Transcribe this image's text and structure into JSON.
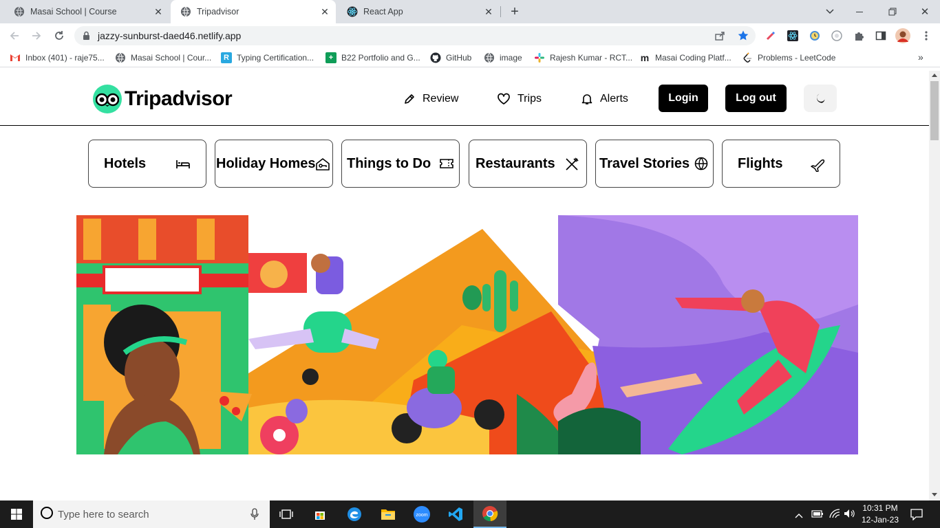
{
  "browser": {
    "tabs": [
      {
        "title": "Masai School | Course",
        "active": false
      },
      {
        "title": "Tripadvisor",
        "active": true
      },
      {
        "title": "React App",
        "active": false
      }
    ],
    "url": "jazzy-sunburst-daed46.netlify.app",
    "bookmarks": [
      {
        "label": "Inbox (401) - raje75...",
        "icon": "gmail-icon"
      },
      {
        "label": "Masai School | Cour...",
        "icon": "globe-icon"
      },
      {
        "label": "Typing Certification...",
        "icon": "typing-icon"
      },
      {
        "label": "B22 Portfolio and G...",
        "icon": "sheets-icon"
      },
      {
        "label": "GitHub",
        "icon": "github-icon"
      },
      {
        "label": "image",
        "icon": "globe-icon"
      },
      {
        "label": "Rajesh Kumar - RCT...",
        "icon": "slack-icon"
      },
      {
        "label": "Masai Coding Platf...",
        "icon": "masai-icon"
      },
      {
        "label": "Problems - LeetCode",
        "icon": "leetcode-icon"
      }
    ]
  },
  "site": {
    "logo": "Tripadvisor",
    "nav": [
      {
        "label": "Review",
        "icon": "pencil-icon"
      },
      {
        "label": "Trips",
        "icon": "heart-icon"
      },
      {
        "label": "Alerts",
        "icon": "bell-icon"
      }
    ],
    "login_label": "Login",
    "logout_label": "Log out",
    "categories": [
      {
        "label": "Hotels",
        "icon": "bed-icon"
      },
      {
        "label": "Holiday Homes",
        "icon": "house-key-icon"
      },
      {
        "label": "Things to Do",
        "icon": "ticket-icon"
      },
      {
        "label": "Restaurants",
        "icon": "fork-knife-icon"
      },
      {
        "label": "Travel Stories",
        "icon": "globe-icon"
      },
      {
        "label": "Flights",
        "icon": "plane-icon"
      }
    ]
  },
  "taskbar": {
    "search_placeholder": "Type here to search",
    "time": "10:31 PM",
    "date": "12-Jan-23"
  }
}
